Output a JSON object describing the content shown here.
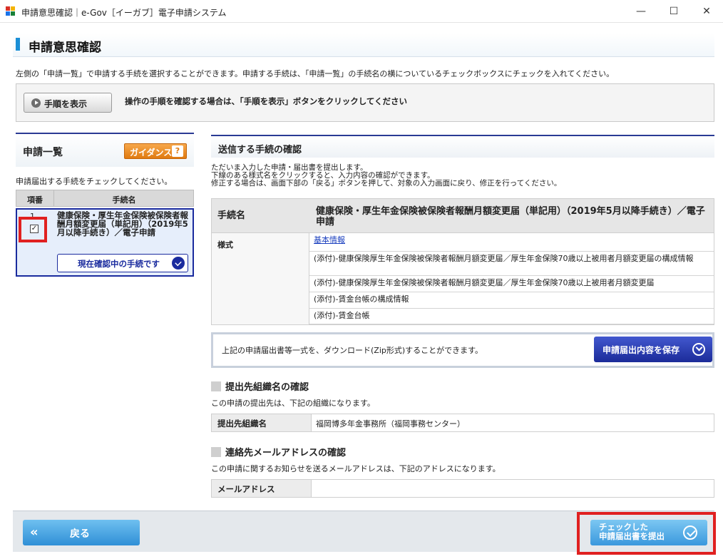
{
  "window": {
    "title": "申請意思確認｜e-Gov［イーガブ］電子申請システム",
    "minimize": "—",
    "maximize": "☐",
    "close": "✕"
  },
  "page": {
    "heading": "申請意思確認",
    "intro": "左側の「申請一覧」で申請する手続を選択することができます。申請する手続は、「申請一覧」の手続名の横についているチェックボックスにチェックを入れてください。"
  },
  "howto": {
    "button_label": "手順を表示",
    "text": "操作の手順を確認する場合は、「手順を表示」ボタンをクリックしてください"
  },
  "left_panel": {
    "title": "申請一覧",
    "guidance_label": "ガイダンス",
    "guidance_q": "?",
    "instruction": "申請届出する手続をチェックしてください。",
    "col_num": "項番",
    "col_name": "手続名",
    "rows": [
      {
        "num": "1",
        "checked": "✓",
        "name": "健康保険・厚生年金保険被保険者報酬月額変更届（単記用）（2019年5月以降手続き）／電子申請",
        "status_button": "現在確認中の手続です"
      }
    ]
  },
  "confirm": {
    "heading": "送信する手続の確認",
    "notes": [
      "ただいま入力した申請・届出書を提出します。",
      "下線のある様式名をクリックすると、入力内容の確認ができます。",
      "修正する場合は、画面下部の「戻る」ボタンを押して、対象の入力画面に戻り、修正を行ってください。"
    ],
    "proc_label": "手続名",
    "proc_value": "健康保険・厚生年金保険被保険者報酬月額変更届（単記用）（2019年5月以降手続き）／電子申請",
    "form_label": "様式",
    "forms": [
      "基本情報",
      "(添付)-健康保険厚生年金保険被保険者報酬月額変更届／厚生年金保険70歳以上被用者月額変更届の構成情報",
      "(添付)-健康保険厚生年金保険被保険者報酬月額変更届／厚生年金保険70歳以上被用者月額変更届",
      "(添付)-賃金台帳の構成情報",
      "(添付)-賃金台帳"
    ]
  },
  "download": {
    "text": "上記の申請届出書等一式を、ダウンロード(Zip形式)することができます。",
    "button_label": "申請届出内容を保存"
  },
  "destination": {
    "heading": "提出先組織名の確認",
    "desc": "この申請の提出先は、下記の組織になります。",
    "key": "提出先組織名",
    "value": "福岡博多年金事務所（福岡事務センター）"
  },
  "email": {
    "heading": "連絡先メールアドレスの確認",
    "desc": "この申請に関するお知らせを送るメールアドレスは、下記のアドレスになります。",
    "key": "メールアドレス",
    "value": ""
  },
  "footer": {
    "back_arrow": "«",
    "back_label": "戻る",
    "submit_line1": "チェックした",
    "submit_line2": "申請届出書を提出"
  },
  "colors": {
    "accent_blue": "#1b2b99",
    "highlight_red": "#e02020",
    "guidance_orange": "#e07a10"
  }
}
